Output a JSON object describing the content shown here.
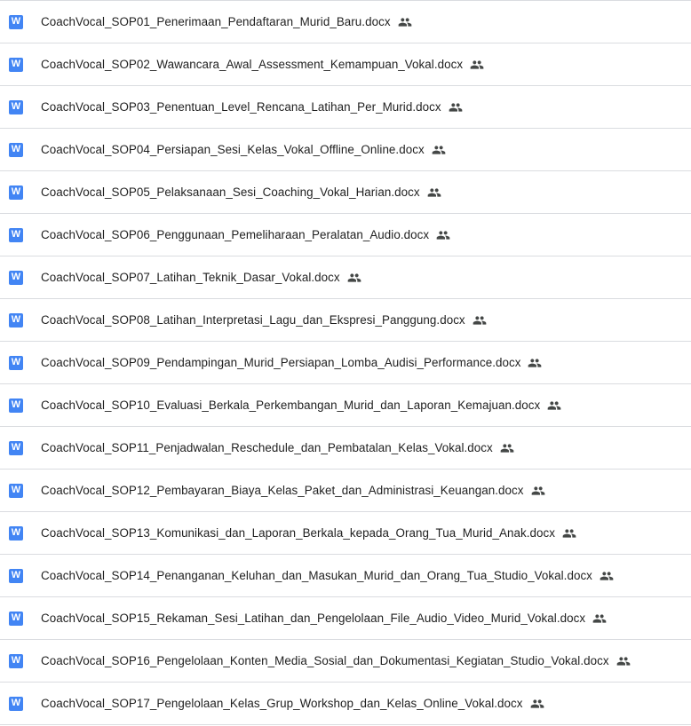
{
  "colors": {
    "doc_icon_bg": "#4285f4",
    "text": "#1f1f1f",
    "shared_icon": "#444746",
    "divider": "#dadce0"
  },
  "icons": {
    "file_type": "word-doc-icon",
    "shared": "shared-people-icon"
  },
  "doc_icon_letter": "W",
  "files": [
    {
      "name": "CoachVocal_SOP01_Penerimaan_Pendaftaran_Murid_Baru.docx",
      "shared": true
    },
    {
      "name": "CoachVocal_SOP02_Wawancara_Awal_Assessment_Kemampuan_Vokal.docx",
      "shared": true
    },
    {
      "name": "CoachVocal_SOP03_Penentuan_Level_Rencana_Latihan_Per_Murid.docx",
      "shared": true
    },
    {
      "name": "CoachVocal_SOP04_Persiapan_Sesi_Kelas_Vokal_Offline_Online.docx",
      "shared": true
    },
    {
      "name": "CoachVocal_SOP05_Pelaksanaan_Sesi_Coaching_Vokal_Harian.docx",
      "shared": true
    },
    {
      "name": "CoachVocal_SOP06_Penggunaan_Pemeliharaan_Peralatan_Audio.docx",
      "shared": true
    },
    {
      "name": "CoachVocal_SOP07_Latihan_Teknik_Dasar_Vokal.docx",
      "shared": true
    },
    {
      "name": "CoachVocal_SOP08_Latihan_Interpretasi_Lagu_dan_Ekspresi_Panggung.docx",
      "shared": true
    },
    {
      "name": "CoachVocal_SOP09_Pendampingan_Murid_Persiapan_Lomba_Audisi_Performance.docx",
      "shared": true
    },
    {
      "name": "CoachVocal_SOP10_Evaluasi_Berkala_Perkembangan_Murid_dan_Laporan_Kemajuan.docx",
      "shared": true
    },
    {
      "name": "CoachVocal_SOP11_Penjadwalan_Reschedule_dan_Pembatalan_Kelas_Vokal.docx",
      "shared": true
    },
    {
      "name": "CoachVocal_SOP12_Pembayaran_Biaya_Kelas_Paket_dan_Administrasi_Keuangan.docx",
      "shared": true
    },
    {
      "name": "CoachVocal_SOP13_Komunikasi_dan_Laporan_Berkala_kepada_Orang_Tua_Murid_Anak.docx",
      "shared": true
    },
    {
      "name": "CoachVocal_SOP14_Penanganan_Keluhan_dan_Masukan_Murid_dan_Orang_Tua_Studio_Vokal.docx",
      "shared": true
    },
    {
      "name": "CoachVocal_SOP15_Rekaman_Sesi_Latihan_dan_Pengelolaan_File_Audio_Video_Murid_Vokal.docx",
      "shared": true
    },
    {
      "name": "CoachVocal_SOP16_Pengelolaan_Konten_Media_Sosial_dan_Dokumentasi_Kegiatan_Studio_Vokal.docx",
      "shared": true
    },
    {
      "name": "CoachVocal_SOP17_Pengelolaan_Kelas_Grup_Workshop_dan_Kelas_Online_Vokal.docx",
      "shared": true
    }
  ]
}
